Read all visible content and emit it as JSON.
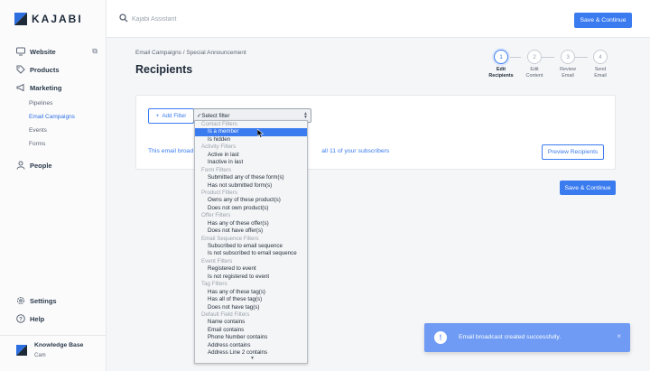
{
  "app": {
    "brand": "KAJABI",
    "accent": "#3a7bf0"
  },
  "sidebar": {
    "items": [
      {
        "label": "Website",
        "icon": "monitor-icon"
      },
      {
        "label": "Products",
        "icon": "tag-icon"
      },
      {
        "label": "Marketing",
        "icon": "megaphone-icon"
      }
    ],
    "sub_items": [
      "Pipelines",
      "Email Campaigns",
      "Events",
      "Forms"
    ],
    "people": "People",
    "settings": "Settings",
    "help": "Help",
    "knowledge_base": {
      "title": "Knowledge Base",
      "subtitle": "Cam"
    }
  },
  "topbar": {
    "search_placeholder": "Kajabi Assistant",
    "save_label": "Save & Continue"
  },
  "breadcrumb": "Email Campaigns / Special Announcement",
  "page_title": "Recipients",
  "steps": [
    {
      "num": "1",
      "line1": "Edit",
      "line2": "Recipients",
      "active": true
    },
    {
      "num": "2",
      "line1": "Edit",
      "line2": "Content",
      "active": false
    },
    {
      "num": "3",
      "line1": "Review",
      "line2": "Email",
      "active": false
    },
    {
      "num": "4",
      "line1": "Send",
      "line2": "Email",
      "active": false
    }
  ],
  "filters": {
    "add_filter_label": "Add Filter",
    "selected": "Select filter",
    "options": [
      {
        "type": "group",
        "text": "Contact Filters"
      },
      {
        "type": "opt",
        "text": "Is a member",
        "highlighted": true
      },
      {
        "type": "opt",
        "text": "Is hidden"
      },
      {
        "type": "group",
        "text": "Activity Filters"
      },
      {
        "type": "opt",
        "text": "Active in last"
      },
      {
        "type": "opt",
        "text": "Inactive in last"
      },
      {
        "type": "group",
        "text": "Form Filters"
      },
      {
        "type": "opt",
        "text": "Submitted any of these form(s)"
      },
      {
        "type": "opt",
        "text": "Has not submitted form(s)"
      },
      {
        "type": "group",
        "text": "Product Filters"
      },
      {
        "type": "opt",
        "text": "Owns any of these product(s)"
      },
      {
        "type": "opt",
        "text": "Does not own product(s)"
      },
      {
        "type": "group",
        "text": "Offer Filters"
      },
      {
        "type": "opt",
        "text": "Has any of these offer(s)"
      },
      {
        "type": "opt",
        "text": "Does not have offer(s)"
      },
      {
        "type": "group",
        "text": "Email Sequence Filters"
      },
      {
        "type": "opt",
        "text": "Subscribed to email sequence"
      },
      {
        "type": "opt",
        "text": "Is not subscribed to email sequence"
      },
      {
        "type": "group",
        "text": "Event Filters"
      },
      {
        "type": "opt",
        "text": "Registered to event"
      },
      {
        "type": "opt",
        "text": "Is not registered to event"
      },
      {
        "type": "group",
        "text": "Tag Filters"
      },
      {
        "type": "opt",
        "text": "Has any of these tag(s)"
      },
      {
        "type": "opt",
        "text": "Has all of these tag(s)"
      },
      {
        "type": "opt",
        "text": "Does not have tag(s)"
      },
      {
        "type": "group",
        "text": "Default Field Filters"
      },
      {
        "type": "opt",
        "text": "Name contains"
      },
      {
        "type": "opt",
        "text": "Email contains"
      },
      {
        "type": "opt",
        "text": "Phone Number contains"
      },
      {
        "type": "opt",
        "text": "Address contains"
      },
      {
        "type": "opt",
        "text": "Address Line 2 contains"
      }
    ]
  },
  "info_text_start": "This email broad",
  "info_text_end": "all 11 of your subscribers",
  "preview_label": "Preview Recipients",
  "save_label": "Save & Continue",
  "toast": {
    "message": "Email broadcast created successfully.",
    "icon": "exclamation-icon",
    "close": "×"
  }
}
